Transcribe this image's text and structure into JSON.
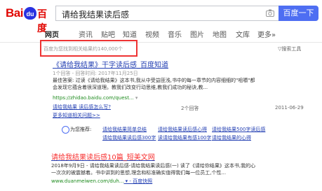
{
  "header": {
    "logo_bai": "Bai",
    "logo_paw": "du",
    "logo_cn": "百度",
    "query": "请给我结果读后感",
    "search_button": "百度一下"
  },
  "tabs": [
    {
      "label": "网页",
      "active": true
    },
    {
      "label": "资讯"
    },
    {
      "label": "贴吧"
    },
    {
      "label": "知道"
    },
    {
      "label": "视频"
    },
    {
      "label": "音乐"
    },
    {
      "label": "图片"
    },
    {
      "label": "地图"
    },
    {
      "label": "文库"
    },
    {
      "label": "更多»"
    }
  ],
  "result_count": "百度为您找到相关结果约140,000个",
  "search_tools": "▽搜索工具",
  "results": [
    {
      "title_prefix": "《请给我结果》干字读后感_百度知道",
      "line1": "1个回答 - 回答时间: 2017年11月25日",
      "line2": "最佳答案: 过读《请给我结果》这本书,我从中受益匪浅,书中的每一章节的内容细细的\"咀嚼\"都",
      "line3": "会发现它蕴含着很深道理。教我们改变行动思维,教我们成功的秘诀,教...",
      "url": "https://zhidao.baidu.com/quest...",
      "url_suffix": " ▾",
      "sub_link": "请给我结果 读后感怎么写?",
      "answers": "2个回答",
      "date": "2011-06-29",
      "more": "更多知道相关问题>>"
    },
    {
      "title": "请给我结果读后感10篇_短美文网",
      "line1": "2018年9月9日 - 请给我结果读后感-请给我结果读后感(一) 读了《请给你结果》这本书,我的心",
      "line2": "一次次的被震撼着。书中讲到的思想,理念和标准确实值得我们每一位员工,个性...",
      "url": "www.duanmeiwen.com/duh...",
      "snapshot": " ▾ - 百度快照"
    }
  ],
  "recommendations": {
    "label": "为您推荐:",
    "items": [
      "请给我结果简单总结",
      "请给我结果读后感心得",
      "请给我结果500字读后感",
      "请给我结果读后感300字",
      "读请给我结果有感100字",
      "请给我结果的心得"
    ]
  },
  "colors": {
    "brand_blue": "#4e6ef2",
    "link_blue": "#2440b3",
    "highlight_red": "#f73131",
    "url_green": "#1e8b1e",
    "annotation_red": "#e33333"
  }
}
